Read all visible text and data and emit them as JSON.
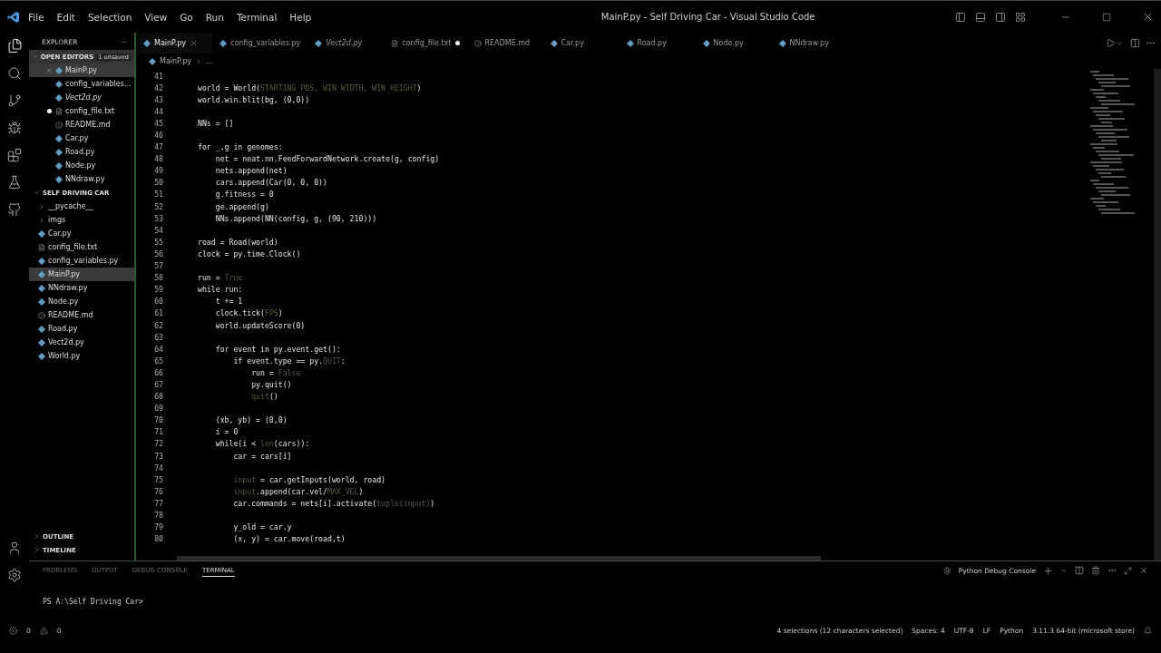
{
  "window": {
    "title": "MainP.py - Self Driving Car - Visual Studio Code"
  },
  "menu": [
    "File",
    "Edit",
    "Selection",
    "View",
    "Go",
    "Run",
    "Terminal",
    "Help"
  ],
  "sidebar": {
    "title": "EXPLORER",
    "more": "···",
    "open_editors": {
      "title": "OPEN EDITORS",
      "badge": "1 unsaved",
      "expanded": true,
      "items": [
        {
          "label": "MainP.py",
          "kind": "py",
          "selected": true,
          "modified": false,
          "italic": false
        },
        {
          "label": "config_variables...",
          "kind": "py",
          "selected": false,
          "modified": false,
          "italic": false
        },
        {
          "label": "Vect2d.py",
          "kind": "py",
          "selected": false,
          "modified": false,
          "italic": true
        },
        {
          "label": "config_file.txt",
          "kind": "txt",
          "selected": false,
          "modified": true,
          "italic": false
        },
        {
          "label": "README.md",
          "kind": "info",
          "selected": false,
          "modified": false,
          "italic": false
        },
        {
          "label": "Car.py",
          "kind": "py",
          "selected": false,
          "modified": false,
          "italic": false
        },
        {
          "label": "Road.py",
          "kind": "py",
          "selected": false,
          "modified": false,
          "italic": false
        },
        {
          "label": "Node.py",
          "kind": "py",
          "selected": false,
          "modified": false,
          "italic": false
        },
        {
          "label": "NNdraw.py",
          "kind": "py",
          "selected": false,
          "modified": false,
          "italic": false
        }
      ]
    },
    "folder": {
      "title": "SELF DRIVING CAR",
      "expanded": true,
      "items": [
        {
          "label": "__pycache__",
          "kind": "folder",
          "selected": false
        },
        {
          "label": "imgs",
          "kind": "folder",
          "selected": false
        },
        {
          "label": "Car.py",
          "kind": "py",
          "selected": false
        },
        {
          "label": "config_file.txt",
          "kind": "txt",
          "selected": false
        },
        {
          "label": "config_variables.py",
          "kind": "py",
          "selected": false
        },
        {
          "label": "MainP.py",
          "kind": "py",
          "selected": true
        },
        {
          "label": "NNdraw.py",
          "kind": "py",
          "selected": false
        },
        {
          "label": "Node.py",
          "kind": "py",
          "selected": false
        },
        {
          "label": "README.md",
          "kind": "info",
          "selected": false
        },
        {
          "label": "Road.py",
          "kind": "py",
          "selected": false
        },
        {
          "label": "Vect2d.py",
          "kind": "py",
          "selected": false
        },
        {
          "label": "World.py",
          "kind": "py",
          "selected": false
        }
      ]
    },
    "sections": [
      {
        "title": "OUTLINE",
        "expanded": false
      },
      {
        "title": "TIMELINE",
        "expanded": false
      }
    ]
  },
  "tabs": [
    {
      "label": "MainP.py",
      "kind": "py",
      "selected": true,
      "modified": false,
      "italic": false
    },
    {
      "label": "config_variables.py",
      "kind": "py",
      "selected": false,
      "modified": false,
      "italic": false
    },
    {
      "label": "Vect2d.py",
      "kind": "py",
      "selected": false,
      "modified": false,
      "italic": true
    },
    {
      "label": "config_file.txt",
      "kind": "txt",
      "selected": false,
      "modified": true,
      "italic": false
    },
    {
      "label": "README.md",
      "kind": "info",
      "selected": false,
      "modified": false,
      "italic": false
    },
    {
      "label": "Car.py",
      "kind": "py",
      "selected": false,
      "modified": false,
      "italic": false
    },
    {
      "label": "Road.py",
      "kind": "py",
      "selected": false,
      "modified": false,
      "italic": false
    },
    {
      "label": "Node.py",
      "kind": "py",
      "selected": false,
      "modified": false,
      "italic": false
    },
    {
      "label": "NNdraw.py",
      "kind": "py",
      "selected": false,
      "modified": false,
      "italic": false
    }
  ],
  "breadcrumb": [
    "MainP.py",
    "..."
  ],
  "editor": {
    "lines": [
      {
        "n": "41"
      },
      {
        "n": "42",
        "tokens": [
          {
            "t": "world = World(",
            "dim": false
          },
          {
            "t": "STARTING_POS, WIN_WIDTH, WIN_HEIGHT",
            "dim": true
          },
          {
            "t": ")",
            "dim": false
          }
        ]
      },
      {
        "n": "43",
        "parts": [
          "world.win.blit(bg, (0,0))"
        ]
      },
      {
        "n": "44"
      },
      {
        "n": "45",
        "parts": [
          "NNs = []"
        ]
      },
      {
        "n": "46"
      },
      {
        "n": "47",
        "parts": [
          "for _,g in genomes:"
        ]
      },
      {
        "n": "48",
        "parts": [
          "    net = neat.nn.FeedForwardNetwork.create(g, config)"
        ]
      },
      {
        "n": "49",
        "parts": [
          "    nets.append(net)"
        ]
      },
      {
        "n": "50",
        "parts": [
          "    cars.append(Car(0, 0, 0))"
        ]
      },
      {
        "n": "51",
        "parts": [
          "    g.fitness = 0"
        ]
      },
      {
        "n": "52",
        "parts": [
          "    ge.append(g)"
        ]
      },
      {
        "n": "53",
        "parts": [
          "    NNs.append(NN(config, g, (90, 210)))"
        ]
      },
      {
        "n": "54"
      },
      {
        "n": "55",
        "parts": [
          "road = Road(world)"
        ]
      },
      {
        "n": "56",
        "parts": [
          "clock = py.time.Clock()"
        ]
      },
      {
        "n": "57"
      },
      {
        "n": "58",
        "tokens": [
          {
            "t": "run = ",
            "dim": false
          },
          {
            "t": "True",
            "dim": true
          }
        ]
      },
      {
        "n": "59",
        "parts": [
          "while run:"
        ]
      },
      {
        "n": "60",
        "parts": [
          "    t += 1"
        ]
      },
      {
        "n": "61",
        "tokens": [
          {
            "t": "    clock.tick(",
            "dim": false
          },
          {
            "t": "FPS",
            "dim": true
          },
          {
            "t": ")",
            "dim": false
          }
        ]
      },
      {
        "n": "62",
        "parts": [
          "    world.updateScore(0)"
        ]
      },
      {
        "n": "63"
      },
      {
        "n": "64",
        "parts": [
          "    for event in py.event.get():"
        ]
      },
      {
        "n": "65",
        "tokens": [
          {
            "t": "        if event.type == py.",
            "dim": false
          },
          {
            "t": "QUIT",
            "dim": true
          },
          {
            "t": ":",
            "dim": false
          }
        ]
      },
      {
        "n": "66",
        "tokens": [
          {
            "t": "            run = ",
            "dim": false
          },
          {
            "t": "False",
            "dim": true
          }
        ]
      },
      {
        "n": "67",
        "parts": [
          "            py.quit()"
        ]
      },
      {
        "n": "68",
        "tokens": [
          {
            "t": "            quit",
            "dim": true
          },
          {
            "t": "()",
            "dim": false
          }
        ]
      },
      {
        "n": "69"
      },
      {
        "n": "70",
        "parts": [
          "    (xb, yb) = (0,0)"
        ]
      },
      {
        "n": "71",
        "parts": [
          "    i = 0"
        ]
      },
      {
        "n": "72",
        "tokens": [
          {
            "t": "    while(i < ",
            "dim": false
          },
          {
            "t": "len",
            "dim": true
          },
          {
            "t": "(cars)):",
            "dim": false
          }
        ]
      },
      {
        "n": "73",
        "parts": [
          "        car = cars[i]"
        ]
      },
      {
        "n": "74"
      },
      {
        "n": "75",
        "tokens": [
          {
            "t": "        input",
            "dim": true
          },
          {
            "t": " = car.getInputs(world, road)",
            "dim": false
          }
        ]
      },
      {
        "n": "76",
        "tokens": [
          {
            "t": "        input",
            "dim": true
          },
          {
            "t": ".append(car.vel/",
            "dim": false
          },
          {
            "t": "MAX_VEL",
            "dim": true
          },
          {
            "t": ")",
            "dim": false
          }
        ]
      },
      {
        "n": "77",
        "tokens": [
          {
            "t": "        car.commands = nets[i].activate(",
            "dim": false
          },
          {
            "t": "tuple(input)",
            "dim": true
          },
          {
            "t": ")",
            "dim": false
          }
        ]
      },
      {
        "n": "78"
      },
      {
        "n": "79",
        "parts": [
          "        y_old = car.y"
        ]
      },
      {
        "n": "80",
        "parts": [
          "        (x, y) = car.move(road,t)"
        ]
      }
    ]
  },
  "panel": {
    "tabs": [
      {
        "label": "PROBLEMS",
        "selected": false
      },
      {
        "label": "OUTPUT",
        "selected": false
      },
      {
        "label": "DEBUG CONSOLE",
        "selected": false
      },
      {
        "label": "TERMINAL",
        "selected": true
      }
    ],
    "terminal_name": "Python Debug Console",
    "prompt": "PS A:\\Self Driving Car>"
  },
  "status_bar": {
    "errors": "0",
    "warnings": "0",
    "selection": "4 selections (12 characters selected)",
    "spaces": "Spaces: 4",
    "encoding": "UTF-8",
    "eol": "LF",
    "language": "Python",
    "interpreter": "3.11.3 64-bit (microsoft store)"
  }
}
